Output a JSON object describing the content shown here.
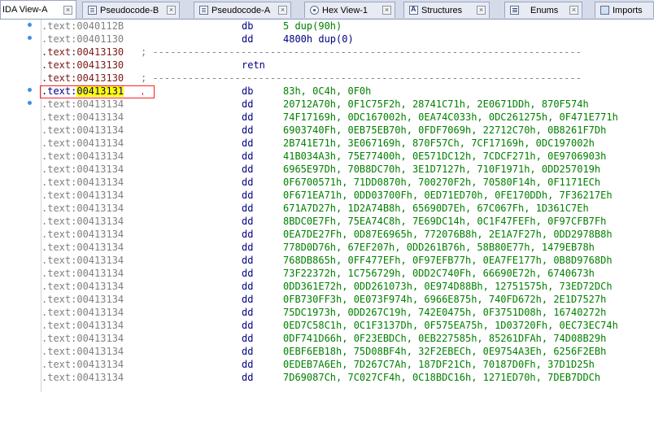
{
  "tabs": [
    {
      "label": "IDA View-A",
      "icon": "",
      "close": "×",
      "active": true
    },
    {
      "label": "Pseudocode-B",
      "icon": "pseudocode-icon",
      "close": "×"
    },
    {
      "label": "Pseudocode-A",
      "icon": "pseudocode-icon",
      "close": "×"
    },
    {
      "label": "Hex View-1",
      "icon": "hex-view-icon",
      "close": "×"
    },
    {
      "label": "Structures",
      "icon": "structures-icon",
      "close": "×"
    },
    {
      "label": "Enums",
      "icon": "enums-icon",
      "close": "×"
    },
    {
      "label": "Imports",
      "icon": "imports-icon",
      "close": ""
    }
  ],
  "colors": {
    "address_gray": "#808080",
    "address_dark": "#7b1a1a",
    "mnemonic": "#000080",
    "operand": "#008000",
    "highlight": "#ffff00",
    "cursor_box": "#ff2020",
    "gutter_dot": "#3f8ee8"
  },
  "listing": {
    "lines": [
      {
        "addr": ".text:0040112B",
        "mnem": "db",
        "ops": "5 dup(90h)",
        "style": "gray",
        "dot": true
      },
      {
        "addr": ".text:00401130",
        "mnem": "dd",
        "ops": "4800h dup(0)",
        "style": "gray",
        "dot": true,
        "ops_dark": true
      },
      {
        "addr": ".text:00413130",
        "sep": "; -------------------------------------------------------------------------",
        "style": "dark"
      },
      {
        "addr": ".text:00413130",
        "mnem": "retn",
        "ops": "",
        "style": "dark"
      },
      {
        "addr": ".text:00413130",
        "sep": "; -------------------------------------------------------------------------",
        "style": "dark"
      },
      {
        "addr_prefix": ".text:",
        "addr_hl": "00413131",
        "mnem": "db",
        "ops": "83h, 0C4h, 0F0h",
        "style": "cur",
        "dot": true
      },
      {
        "addr": ".text:00413134",
        "mnem": "dd",
        "ops": "20712A70h, 0F1C75F2h, 28741C71h, 2E0671DDh, 870F574h",
        "style": "gray",
        "dot": true
      },
      {
        "addr": ".text:00413134",
        "mnem": "dd",
        "ops": "74F17169h, 0DC167002h, 0EA74C033h, 0DC261275h, 0F471E771h",
        "style": "gray"
      },
      {
        "addr": ".text:00413134",
        "mnem": "dd",
        "ops": "6903740Fh, 0EB75EB70h, 0FDF7069h, 22712C70h, 0B8261F7Dh",
        "style": "gray"
      },
      {
        "addr": ".text:00413134",
        "mnem": "dd",
        "ops": "2B741E71h, 3E067169h, 870F57Ch, 7CF17169h, 0DC197002h",
        "style": "gray"
      },
      {
        "addr": ".text:00413134",
        "mnem": "dd",
        "ops": "41B034A3h, 75E77400h, 0E571DC12h, 7CDCF271h, 0E9706903h",
        "style": "gray"
      },
      {
        "addr": ".text:00413134",
        "mnem": "dd",
        "ops": "6965E97Dh, 70B8DC70h, 3E1D7127h, 710F1971h, 0DD257019h",
        "style": "gray"
      },
      {
        "addr": ".text:00413134",
        "mnem": "dd",
        "ops": "0F6700571h, 71DD0870h, 700270F2h, 70580F14h, 0F1171ECh",
        "style": "gray"
      },
      {
        "addr": ".text:00413134",
        "mnem": "dd",
        "ops": "0F671EA71h, 0DD03700Fh, 0ED71ED70h, 0FE170DDh, 7F36217Eh",
        "style": "gray"
      },
      {
        "addr": ".text:00413134",
        "mnem": "dd",
        "ops": "671A7D27h, 1D2A74B8h, 65690D7Eh, 67C067Fh, 1D361C7Eh",
        "style": "gray"
      },
      {
        "addr": ".text:00413134",
        "mnem": "dd",
        "ops": "8BDC0E7Fh, 75EA74C8h, 7E69DC14h, 0C1F47FEFh, 0F97CFB7Fh",
        "style": "gray"
      },
      {
        "addr": ".text:00413134",
        "mnem": "dd",
        "ops": "0EA7DE27Fh, 0D87E6965h, 772076B8h, 2E1A7F27h, 0DD2978B8h",
        "style": "gray"
      },
      {
        "addr": ".text:00413134",
        "mnem": "dd",
        "ops": "778D0D76h, 67EF207h, 0DD261B76h, 58B80E77h, 1479EB78h",
        "style": "gray"
      },
      {
        "addr": ".text:00413134",
        "mnem": "dd",
        "ops": "768DB865h, 0FF477EFh, 0F97EFB77h, 0EA7FE177h, 0B8D9768Dh",
        "style": "gray"
      },
      {
        "addr": ".text:00413134",
        "mnem": "dd",
        "ops": "73F22372h, 1C756729h, 0DD2C740Fh, 66690E72h, 6740673h",
        "style": "gray"
      },
      {
        "addr": ".text:00413134",
        "mnem": "dd",
        "ops": "0DD361E72h, 0DD261073h, 0E974D88Bh, 12751575h, 73ED72DCh",
        "style": "gray"
      },
      {
        "addr": ".text:00413134",
        "mnem": "dd",
        "ops": "0FB730FF3h, 0E073F974h, 6966E875h, 740FD672h, 2E1D7527h",
        "style": "gray"
      },
      {
        "addr": ".text:00413134",
        "mnem": "dd",
        "ops": "75DC1973h, 0DD267C19h, 742E0475h, 0F3751D08h, 16740272h",
        "style": "gray"
      },
      {
        "addr": ".text:00413134",
        "mnem": "dd",
        "ops": "0ED7C58C1h, 0C1F3137Dh, 0F575EA75h, 1D03720Fh, 0EC73EC74h",
        "style": "gray"
      },
      {
        "addr": ".text:00413134",
        "mnem": "dd",
        "ops": "0DF741D66h, 0F23EBDCh, 0EB227585h, 85261DFAh, 74D08B29h",
        "style": "gray"
      },
      {
        "addr": ".text:00413134",
        "mnem": "dd",
        "ops": "0EBF6EB18h, 75D08BF4h, 32F2EBECh, 0E9754A3Eh, 6256F2EBh",
        "style": "gray"
      },
      {
        "addr": ".text:00413134",
        "mnem": "dd",
        "ops": "0EDEB7A6Eh, 7D267C7Ah, 187DF21Ch, 70187D0Fh, 37D1D25h",
        "style": "gray"
      },
      {
        "addr": ".text:00413134",
        "mnem": "dd",
        "ops": "7D69087Ch, 7C027CF4h, 0C18BDC16h, 1271ED70h, 7DEB7DDCh",
        "style": "gray"
      }
    ]
  }
}
